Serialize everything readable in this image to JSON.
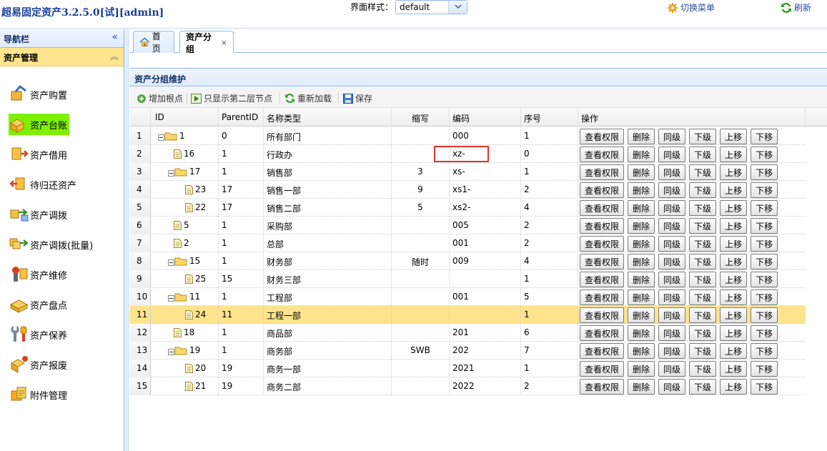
{
  "app": {
    "title": "超易固定资产3.2.5.0[试][admin]"
  },
  "theme": {
    "label": "界面样式：",
    "value": "default"
  },
  "header_links": {
    "switch_menu": "切换菜单",
    "refresh": "刷新"
  },
  "sidebar": {
    "nav_title": "导航栏",
    "section_title": "资产管理",
    "items": [
      {
        "label": "资产购置",
        "icon": "purchase-icon"
      },
      {
        "label": "资产台账",
        "icon": "ledger-icon",
        "active": true
      },
      {
        "label": "资产借用",
        "icon": "borrow-icon"
      },
      {
        "label": "待归还资产",
        "icon": "return-icon"
      },
      {
        "label": "资产调拨",
        "icon": "transfer-icon"
      },
      {
        "label": "资产调拨(批量)",
        "icon": "batch-transfer-icon"
      },
      {
        "label": "资产维修",
        "icon": "repair-icon"
      },
      {
        "label": "资产盘点",
        "icon": "inventory-icon"
      },
      {
        "label": "资产保养",
        "icon": "maintenance-icon"
      },
      {
        "label": "资产报废",
        "icon": "scrap-icon"
      },
      {
        "label": "附件管理",
        "icon": "attachment-icon"
      }
    ]
  },
  "tabs": [
    {
      "label": "首页",
      "icon": "home-icon"
    },
    {
      "label": "资产分组",
      "closable": true,
      "active": true
    }
  ],
  "panel": {
    "title": "资产分组维护"
  },
  "toolbar": {
    "add_root": "增加根点",
    "show_second_level": "只显示第二层节点",
    "reload": "重新加载",
    "save": "保存"
  },
  "grid": {
    "columns": [
      "ID",
      "ParentID",
      "名称类型",
      "缩写",
      "编码",
      "序号",
      "操作"
    ],
    "actions": [
      "查看权限",
      "删除",
      "同级",
      "下级",
      "上移",
      "下移"
    ],
    "selected_row": 11,
    "rows": [
      {
        "n": "1",
        "id": "1",
        "pid": "0",
        "name": "所有部门",
        "abbr": "",
        "code": "000",
        "seq": "1",
        "depth": 0,
        "folder": true
      },
      {
        "n": "2",
        "id": "16",
        "pid": "1",
        "name": "行政办",
        "abbr": "",
        "code": "xz-",
        "seq": "0",
        "depth": 1,
        "folder": false
      },
      {
        "n": "3",
        "id": "17",
        "pid": "1",
        "name": "销售部",
        "abbr": "3",
        "code": "xs-",
        "seq": "1",
        "depth": 1,
        "folder": true
      },
      {
        "n": "4",
        "id": "23",
        "pid": "17",
        "name": "销售一部",
        "abbr": "9",
        "code": "xs1-",
        "seq": "2",
        "depth": 2,
        "folder": false
      },
      {
        "n": "5",
        "id": "22",
        "pid": "17",
        "name": "销售二部",
        "abbr": "5",
        "code": "xs2-",
        "seq": "4",
        "depth": 2,
        "folder": false
      },
      {
        "n": "6",
        "id": "5",
        "pid": "1",
        "name": "采购部",
        "abbr": "",
        "code": "005",
        "seq": "2",
        "depth": 1,
        "folder": false
      },
      {
        "n": "7",
        "id": "2",
        "pid": "1",
        "name": "总部",
        "abbr": "",
        "code": "001",
        "seq": "2",
        "depth": 1,
        "folder": false
      },
      {
        "n": "8",
        "id": "15",
        "pid": "1",
        "name": "财务部",
        "abbr": "随时",
        "code": "009",
        "seq": "4",
        "depth": 1,
        "folder": true
      },
      {
        "n": "9",
        "id": "25",
        "pid": "15",
        "name": "财务三部",
        "abbr": "",
        "code": "",
        "seq": "1",
        "depth": 2,
        "folder": false
      },
      {
        "n": "10",
        "id": "11",
        "pid": "1",
        "name": "工程部",
        "abbr": "",
        "code": "001",
        "seq": "5",
        "depth": 1,
        "folder": true
      },
      {
        "n": "11",
        "id": "24",
        "pid": "11",
        "name": "工程一部",
        "abbr": "",
        "code": "",
        "seq": "1",
        "depth": 2,
        "folder": false
      },
      {
        "n": "12",
        "id": "18",
        "pid": "1",
        "name": "商品部",
        "abbr": "",
        "code": "201",
        "seq": "6",
        "depth": 1,
        "folder": false
      },
      {
        "n": "13",
        "id": "19",
        "pid": "1",
        "name": "商务部",
        "abbr": "SWB",
        "code": "202",
        "seq": "7",
        "depth": 1,
        "folder": true
      },
      {
        "n": "14",
        "id": "20",
        "pid": "19",
        "name": "商务一部",
        "abbr": "",
        "code": "2021",
        "seq": "1",
        "depth": 2,
        "folder": false
      },
      {
        "n": "15",
        "id": "21",
        "pid": "19",
        "name": "商务二部",
        "abbr": "",
        "code": "2022",
        "seq": "2",
        "depth": 2,
        "folder": false
      }
    ]
  }
}
